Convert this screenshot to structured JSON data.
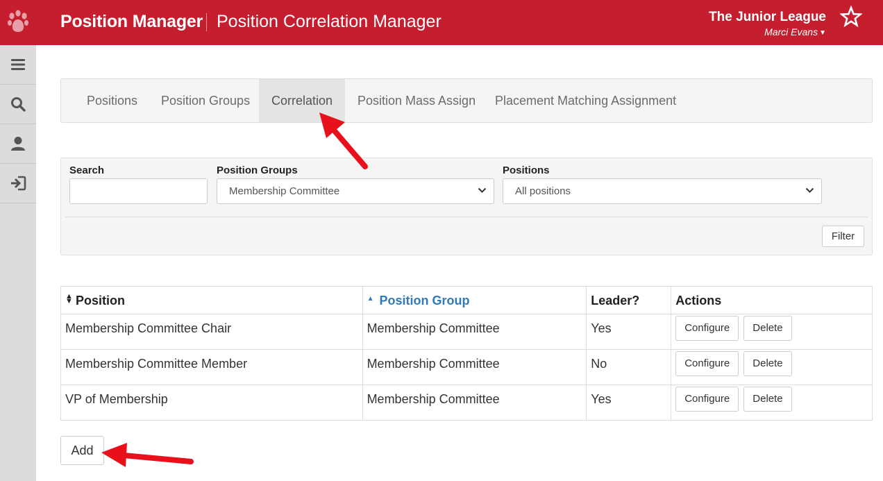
{
  "header": {
    "app_title": "Position Manager",
    "page_title": "Position Correlation Manager",
    "org_name": "The Junior League",
    "user_name": "Marci Evans",
    "brand_color": "#c41e2f"
  },
  "sidebar": {
    "items": [
      {
        "icon": "menu-icon"
      },
      {
        "icon": "search-icon"
      },
      {
        "icon": "user-icon"
      },
      {
        "icon": "logout-icon"
      }
    ]
  },
  "tabs": [
    {
      "label": "Positions",
      "active": false
    },
    {
      "label": "Position Groups",
      "active": false
    },
    {
      "label": "Correlation",
      "active": true
    },
    {
      "label": "Position Mass Assign",
      "active": false
    },
    {
      "label": "Placement Matching Assignment",
      "active": false
    }
  ],
  "filters": {
    "search_label": "Search",
    "search_value": "",
    "position_groups_label": "Position Groups",
    "position_groups_selected": "Membership Committee",
    "positions_label": "Positions",
    "positions_selected": "All positions",
    "filter_button": "Filter"
  },
  "table": {
    "headers": [
      "Position",
      "Position Group",
      "Leader?",
      "Actions"
    ],
    "sorted_column": "Position Group",
    "rows": [
      {
        "position": "Membership Committee Chair",
        "group": "Membership Committee",
        "leader": "Yes"
      },
      {
        "position": "Membership Committee Member",
        "group": "Membership Committee",
        "leader": "No"
      },
      {
        "position": "VP of Membership",
        "group": "Membership Committee",
        "leader": "Yes"
      }
    ],
    "configure_label": "Configure",
    "delete_label": "Delete"
  },
  "add_button": "Add",
  "annotation_color": "#e8111b"
}
